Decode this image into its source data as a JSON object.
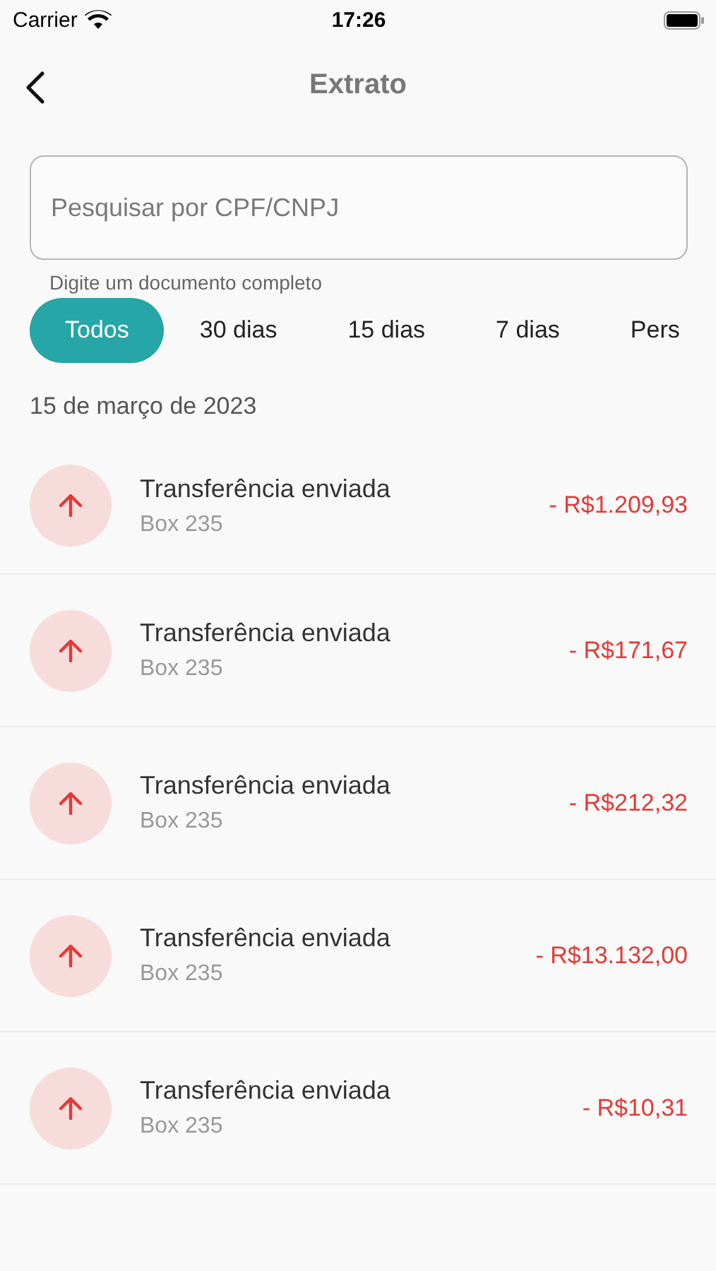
{
  "status_bar": {
    "carrier": "Carrier",
    "time": "17:26"
  },
  "header": {
    "title": "Extrato"
  },
  "search": {
    "placeholder": "Pesquisar por CPF/CNPJ",
    "hint": "Digite um documento completo"
  },
  "filters": [
    {
      "label": "Todos",
      "selected": true
    },
    {
      "label": "30 dias",
      "selected": false
    },
    {
      "label": "15 dias",
      "selected": false
    },
    {
      "label": "7 dias",
      "selected": false
    },
    {
      "label": "Pers",
      "selected": false
    }
  ],
  "date": "15 de março de 2023",
  "transactions": [
    {
      "kind": "sent",
      "title": "Transferência enviada",
      "subtitle": "Box 235",
      "amount": "- R$1.209,93"
    },
    {
      "kind": "sent",
      "title": "Transferência enviada",
      "subtitle": "Box 235",
      "amount": "- R$171,67"
    },
    {
      "kind": "sent",
      "title": "Transferência enviada",
      "subtitle": "Box 235",
      "amount": "- R$212,32"
    },
    {
      "kind": "sent",
      "title": "Transferência enviada",
      "subtitle": "Box 235",
      "amount": "- R$13.132,00"
    },
    {
      "kind": "sent",
      "title": "Transferência enviada",
      "subtitle": "Box 235",
      "amount": "- R$10,31"
    }
  ]
}
